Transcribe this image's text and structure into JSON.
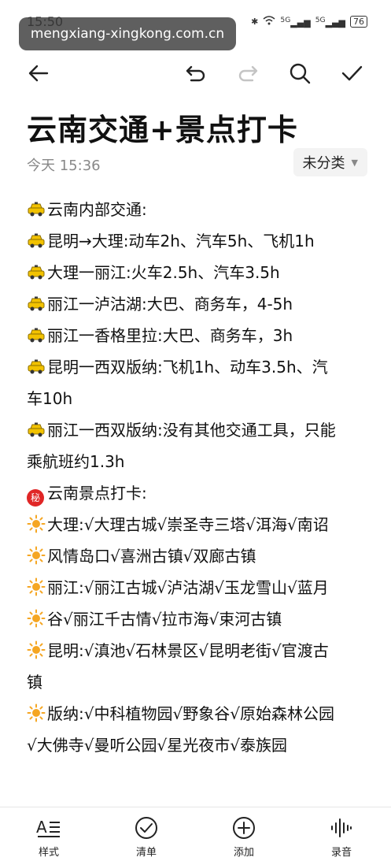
{
  "status_bar": {
    "time": "15:50",
    "signal_1": "5G",
    "signal_2": "5G",
    "battery": "76"
  },
  "watermark": "mengxiang-xingkong.com.cn",
  "note": {
    "title": "云南交通+景点打卡",
    "date": "今天 15:36",
    "category": "未分类",
    "lines": [
      {
        "icon": "taxi",
        "text": "云南内部交通:"
      },
      {
        "icon": "taxi",
        "text": "昆明→大理:动车2h、汽车5h、飞机1h"
      },
      {
        "icon": "taxi",
        "text": "大理一丽江:火车2.5h、汽车3.5h"
      },
      {
        "icon": "taxi",
        "text": "丽江一泸沽湖:大巴、商务车，4-5h"
      },
      {
        "icon": "taxi",
        "text": "丽江一香格里拉:大巴、商务车，3h"
      },
      {
        "icon": "taxi",
        "text": "昆明一西双版纳:飞机1h、动车3.5h、汽"
      },
      {
        "icon": "",
        "text": "车10h"
      },
      {
        "icon": "taxi",
        "text": "丽江一西双版纳:没有其他交通工具，只能"
      },
      {
        "icon": "",
        "text": "乘航班约1.3h"
      },
      {
        "icon": "secret",
        "text": "云南景点打卡:"
      },
      {
        "icon": "sun",
        "text": "大理:√大理古城√崇圣寺三塔√洱海√南诏"
      },
      {
        "icon": "sun",
        "text": "风情岛口√喜洲古镇√双廊古镇"
      },
      {
        "icon": "sun",
        "text": "丽江:√丽江古城√泸沽湖√玉龙雪山√蓝月"
      },
      {
        "icon": "sun",
        "text": "谷√丽江千古情√拉市海√束河古镇"
      },
      {
        "icon": "sun",
        "text": "昆明:√滇池√石林景区√昆明老街√官渡古"
      },
      {
        "icon": "",
        "text": "镇"
      },
      {
        "icon": "sun",
        "text": "版纳:√中科植物园√野象谷√原始森林公园"
      },
      {
        "icon": "",
        "text": "√大佛寺√曼听公园√星光夜市√泰族园"
      }
    ]
  },
  "secret_glyph": "秘",
  "bottom_bar": {
    "style": "样式",
    "checklist": "清单",
    "add": "添加",
    "record": "录音"
  },
  "colors": {
    "secret_badge": "#e02626",
    "sun": "#f5a623",
    "taxi": "#f2c200"
  }
}
